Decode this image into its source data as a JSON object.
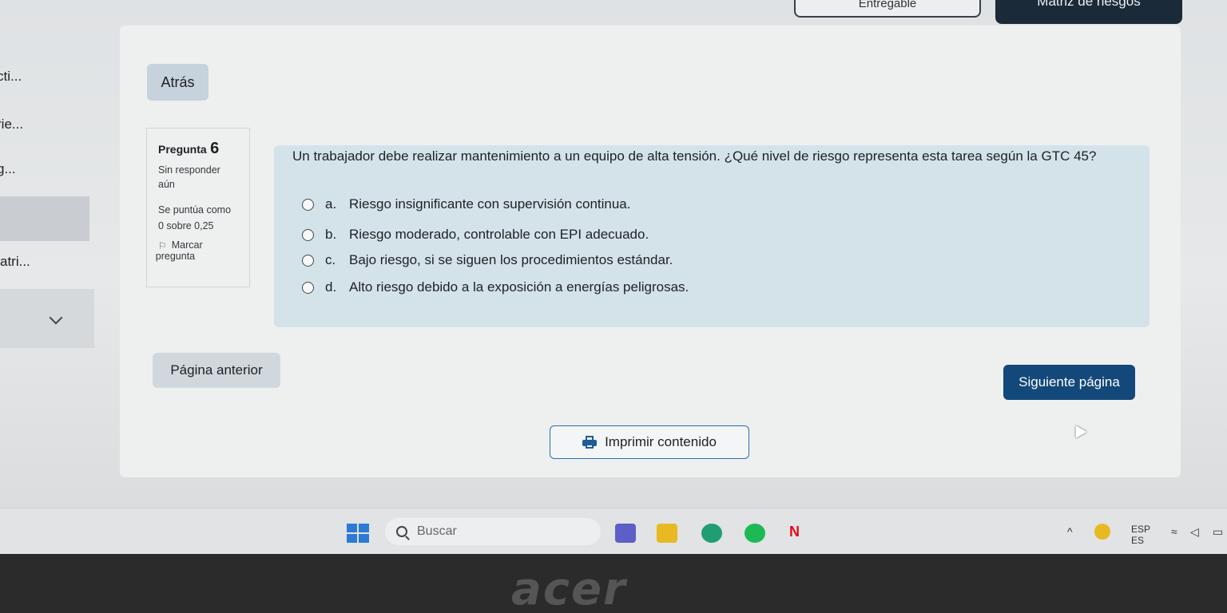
{
  "top": {
    "button_outline_label": "Entregable",
    "button_dark_label": "Matriz de riesgos"
  },
  "sidebar": {
    "items": [
      {
        "label": "cti..."
      },
      {
        "label": "rie..."
      },
      {
        "label": "g..."
      },
      {
        "label": "atri..."
      }
    ]
  },
  "nav": {
    "back_label": "Atrás"
  },
  "question": {
    "label": "Pregunta",
    "number": "6",
    "status_line1": "Sin responder",
    "status_line2": "aún",
    "score_line1": "Se puntúa como",
    "score_line2": "0 sobre 0,25",
    "flag_line1": "Marcar",
    "flag_line2": "pregunta",
    "text": "Un trabajador debe realizar mantenimiento a un equipo de alta tensión. ¿Qué nivel de riesgo representa esta tarea según la GTC 45?",
    "options": [
      {
        "letter": "a.",
        "text": "Riesgo insignificante con supervisión continua."
      },
      {
        "letter": "b.",
        "text": "Riesgo moderado, controlable con EPI adecuado."
      },
      {
        "letter": "c.",
        "text": "Bajo riesgo, si se siguen los procedimientos estándar."
      },
      {
        "letter": "d.",
        "text": "Alto riesgo debido a la exposición a energías peligrosas."
      }
    ]
  },
  "pagination": {
    "prev_label": "Página anterior",
    "next_label": "Siguiente página"
  },
  "print": {
    "label": "Imprimir contenido"
  },
  "taskbar": {
    "search_placeholder": "Buscar",
    "lang_line1": "ESP",
    "lang_line2": "ES"
  },
  "brand": {
    "logo_text": "acer"
  },
  "colors": {
    "primary": "#13487a",
    "question_panel": "#d4e3e9",
    "outline_accent": "#2b6cb0"
  }
}
